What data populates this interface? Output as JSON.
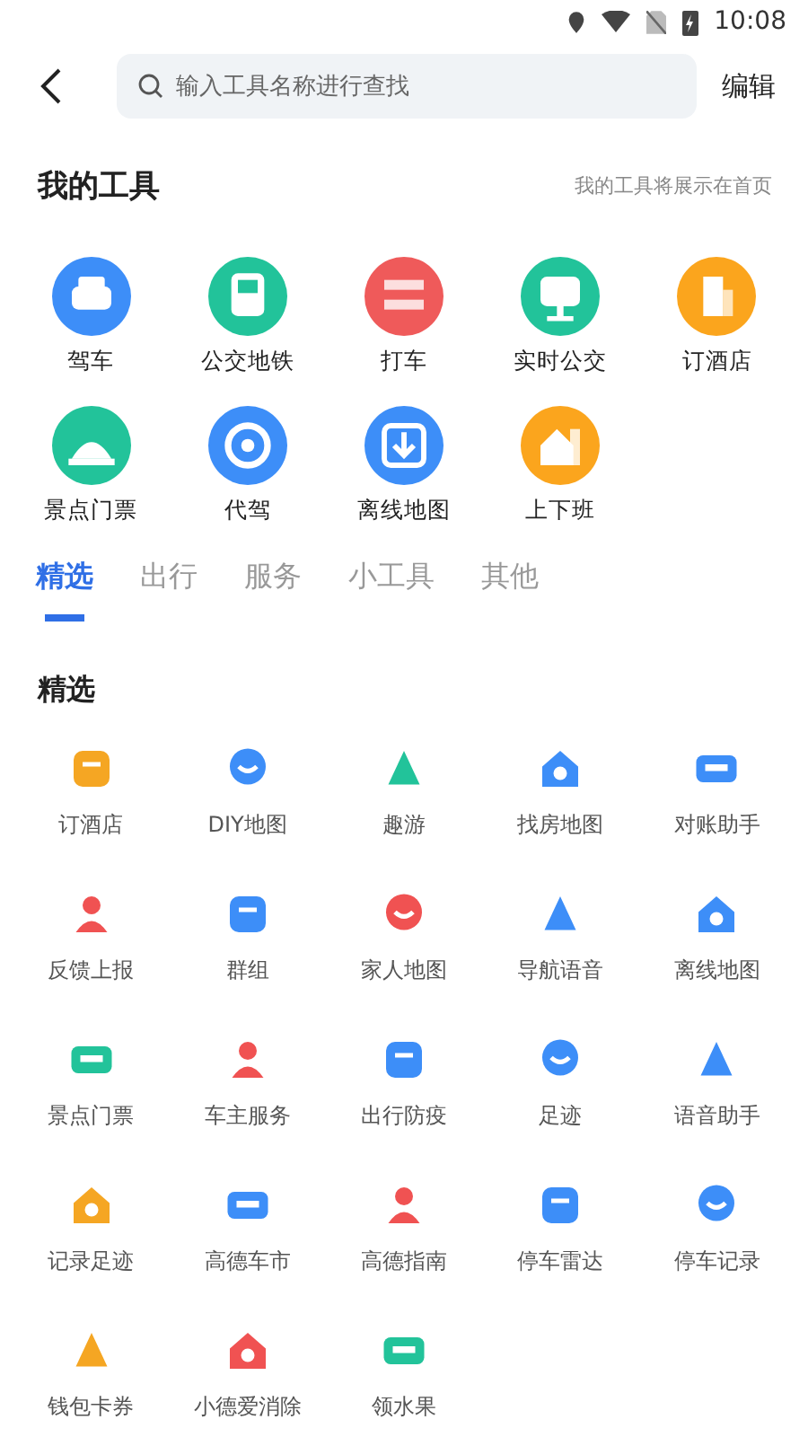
{
  "status_bar": {
    "time": "10:08"
  },
  "header": {
    "search": {
      "placeholder": "输入工具名称进行查找"
    },
    "edit": "编辑"
  },
  "my_tools": {
    "title": "我的工具",
    "hint": "我的工具将展示在首页",
    "items": [
      {
        "label": "驾车",
        "color": "#3d8ef8"
      },
      {
        "label": "公交地铁",
        "color": "#22c39a"
      },
      {
        "label": "打车",
        "color": "#ef5a5a"
      },
      {
        "label": "实时公交",
        "color": "#22c39a"
      },
      {
        "label": "订酒店",
        "color": "#fba51d"
      },
      {
        "label": "景点门票",
        "color": "#22c39a"
      },
      {
        "label": "代驾",
        "color": "#3d8ef8"
      },
      {
        "label": "离线地图",
        "color": "#3d8ef8"
      },
      {
        "label": "上下班",
        "color": "#fba51d"
      }
    ]
  },
  "tabs": [
    {
      "label": "精选",
      "selected": true
    },
    {
      "label": "出行",
      "selected": false
    },
    {
      "label": "服务",
      "selected": false
    },
    {
      "label": "小工具",
      "selected": false
    },
    {
      "label": "其他",
      "selected": false
    }
  ],
  "section": {
    "title": "精选",
    "items": [
      {
        "label": "订酒店",
        "color": "#f5a623"
      },
      {
        "label": "DIY地图",
        "color": "#3d8ef8"
      },
      {
        "label": "趣游",
        "color": "#22c39a"
      },
      {
        "label": "找房地图",
        "color": "#3d8ef8"
      },
      {
        "label": "对账助手",
        "color": "#3d8ef8"
      },
      {
        "label": "反馈上报",
        "color": "#f05252"
      },
      {
        "label": "群组",
        "color": "#3d8ef8"
      },
      {
        "label": "家人地图",
        "color": "#f05252"
      },
      {
        "label": "导航语音",
        "color": "#3d8ef8"
      },
      {
        "label": "离线地图",
        "color": "#3d8ef8"
      },
      {
        "label": "景点门票",
        "color": "#22c39a"
      },
      {
        "label": "车主服务",
        "color": "#f05252"
      },
      {
        "label": "出行防疫",
        "color": "#3d8ef8"
      },
      {
        "label": "足迹",
        "color": "#3d8ef8"
      },
      {
        "label": "语音助手",
        "color": "#3d8ef8"
      },
      {
        "label": "记录足迹",
        "color": "#f5a623"
      },
      {
        "label": "高德车市",
        "color": "#3d8ef8"
      },
      {
        "label": "高德指南",
        "color": "#f05252"
      },
      {
        "label": "停车雷达",
        "color": "#3d8ef8"
      },
      {
        "label": "停车记录",
        "color": "#3d8ef8"
      },
      {
        "label": "钱包卡券",
        "color": "#f5a623"
      },
      {
        "label": "小德爱消除",
        "color": "#f05252"
      },
      {
        "label": "领水果",
        "color": "#22c39a"
      }
    ]
  }
}
